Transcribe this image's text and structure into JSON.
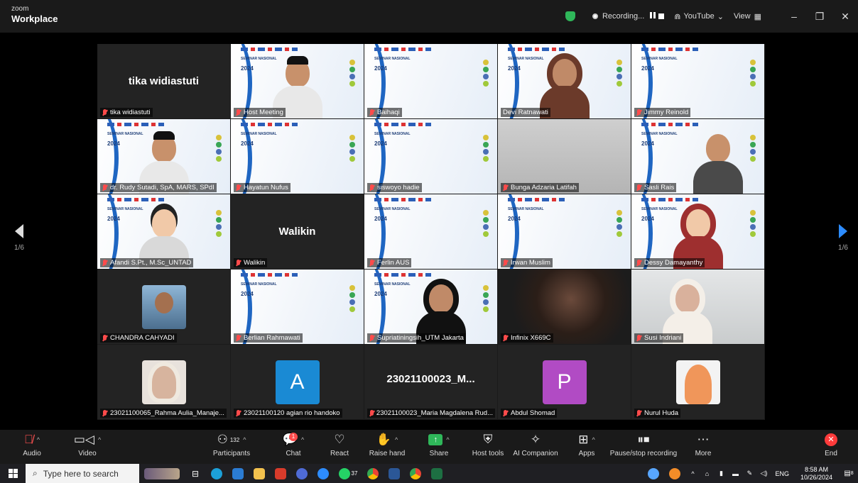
{
  "app": {
    "brand_top": "zoom",
    "brand_bottom": "Workplace"
  },
  "titlebar": {
    "recording_label": "Recording...",
    "youtube_label": "YouTube",
    "view_label": "View",
    "minimize": "–",
    "restore": "❐",
    "close": "✕"
  },
  "pagination": {
    "left_label": "1/6",
    "right_label": "1/6"
  },
  "slide": {
    "header": "SEMINAR NASIONAL",
    "year": "2024"
  },
  "tiles": [
    {
      "name": "tika widiastuti",
      "big": "tika widiastuti"
    },
    {
      "name": "Host Meeting"
    },
    {
      "name": "Baihaqi"
    },
    {
      "name": "Devi Ratnawati"
    },
    {
      "name": "Jimmy Reinold"
    },
    {
      "name": "dr. Rudy Sutadi, SpA, MARS, SPdI"
    },
    {
      "name": "Hayatun Nufus"
    },
    {
      "name": "siswoyo hadie"
    },
    {
      "name": "Bunga Adzaria Latifah"
    },
    {
      "name": "Sasli Rais"
    },
    {
      "name": "Afandi S.Pt., M.Sc_UNTAD"
    },
    {
      "name": "Walikin",
      "big": "Walikin"
    },
    {
      "name": "Ferlin AUS"
    },
    {
      "name": "Irwan Muslim"
    },
    {
      "name": "Dessy Damayanthy"
    },
    {
      "name": "CHANDRA CAHYADI"
    },
    {
      "name": "Berlian Rahmawati"
    },
    {
      "name": "Supriatiningsih_UTM Jakarta"
    },
    {
      "name": "Infinix X669C"
    },
    {
      "name": "Susi  Indriani"
    },
    {
      "name": "23021100065_Rahma Aulia_Manaje..."
    },
    {
      "name": "23021100120 agian rio handoko",
      "letter": "A"
    },
    {
      "name": "23021100023_Maria Magdalena Rud...",
      "big": "23021100023_M..."
    },
    {
      "name": "Abdul Shomad",
      "letter": "P"
    },
    {
      "name": "Nurul Huda"
    }
  ],
  "toolbar": {
    "audio": "Audio",
    "video": "Video",
    "participants": "Participants",
    "participants_count": "132",
    "chat": "Chat",
    "chat_badge": "1",
    "react": "React",
    "raise_hand": "Raise hand",
    "share": "Share",
    "host_tools": "Host tools",
    "ai_companion": "AI Companion",
    "apps": "Apps",
    "pause_stop": "Pause/stop recording",
    "more": "More",
    "end": "End"
  },
  "taskbar": {
    "search_placeholder": "Type here to search",
    "whatsapp_badge": "37",
    "lang": "ENG",
    "time": "8:58 AM",
    "date": "10/26/2024",
    "notif_count": "8"
  },
  "colors": {
    "active_border": "#3dd68c",
    "accent": "#2d8cff",
    "mute_red": "#ff4b4b",
    "share_green": "#2fb75a",
    "letter_a": "#1a8ad4",
    "letter_p": "#b14bc4"
  }
}
